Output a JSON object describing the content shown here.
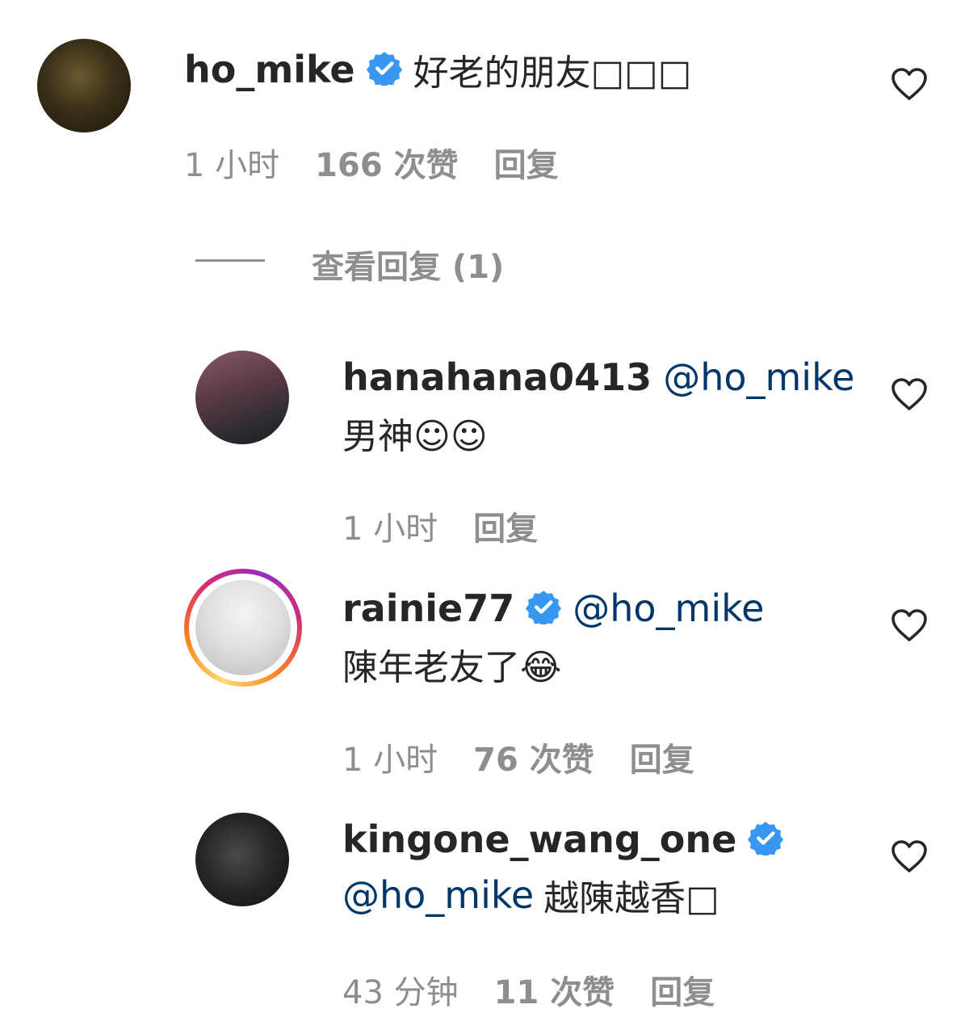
{
  "comments": [
    {
      "username": "ho_mike",
      "verified": true,
      "text": "好老的朋友□□□",
      "time": "1 小时",
      "likes": "166 次赞",
      "reply": "回复",
      "view_replies": "查看回复 (1)",
      "avatar_icon": "user-avatar-photo"
    },
    {
      "username": "hanahana0413",
      "verified": false,
      "mention": "@ho_mike",
      "text": "男神☺☺",
      "time": "1 小时",
      "reply": "回复",
      "avatar_icon": "user-avatar-photo"
    },
    {
      "username": "rainie77",
      "verified": true,
      "mention": "@ho_mike",
      "text": "陳年老友了😂",
      "time": "1 小时",
      "likes": "76 次赞",
      "reply": "回复",
      "avatar_icon": "user-avatar-photo"
    },
    {
      "username": "kingone_wang_one",
      "verified": true,
      "mention": "@ho_mike",
      "text": "越陳越香□",
      "time": "43 分钟",
      "likes": "11 次赞",
      "reply": "回复",
      "avatar_icon": "user-avatar-photo"
    }
  ],
  "colors": {
    "verified": "#3897f0",
    "mention": "#00376b",
    "meta": "#8e8e8e",
    "text": "#262626"
  },
  "icons": {
    "like": "heart-outline-icon",
    "verified": "verified-badge-icon"
  }
}
